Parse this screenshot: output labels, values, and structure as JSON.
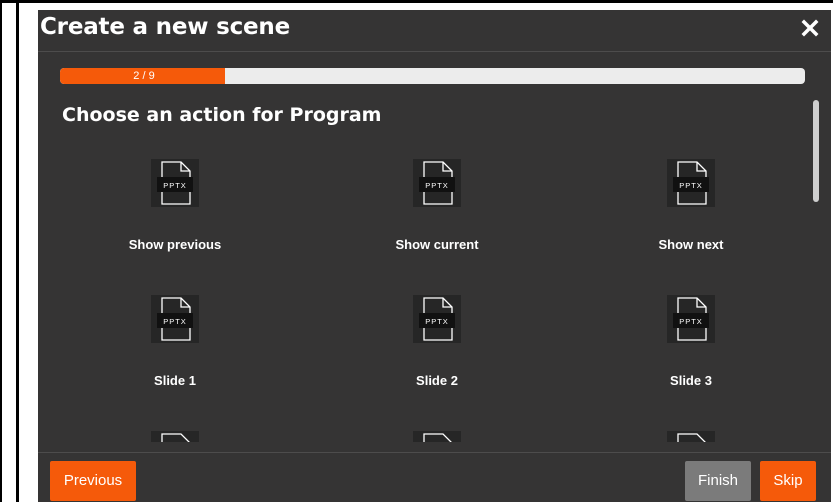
{
  "dialog": {
    "title": "Create a new scene",
    "close_icon": "close-icon",
    "progress": {
      "label": "2 / 9",
      "fraction": 0.222,
      "color": "#f55a0a"
    },
    "heading": "Choose an action for Program",
    "actions": [
      {
        "label": "Show previous",
        "icon": "pptx-file-icon",
        "icon_text": "PPTX"
      },
      {
        "label": "Show current",
        "icon": "pptx-file-icon",
        "icon_text": "PPTX"
      },
      {
        "label": "Show next",
        "icon": "pptx-file-icon",
        "icon_text": "PPTX"
      },
      {
        "label": "Slide 1",
        "icon": "pptx-file-icon",
        "icon_text": "PPTX"
      },
      {
        "label": "Slide 2",
        "icon": "pptx-file-icon",
        "icon_text": "PPTX"
      },
      {
        "label": "Slide 3",
        "icon": "pptx-file-icon",
        "icon_text": "PPTX"
      }
    ],
    "footer": {
      "previous_label": "Previous",
      "finish_label": "Finish",
      "skip_label": "Skip"
    }
  },
  "colors": {
    "accent": "#f55a0a",
    "dialog_bg": "#353434",
    "finish_bg": "#7b7b7b"
  }
}
